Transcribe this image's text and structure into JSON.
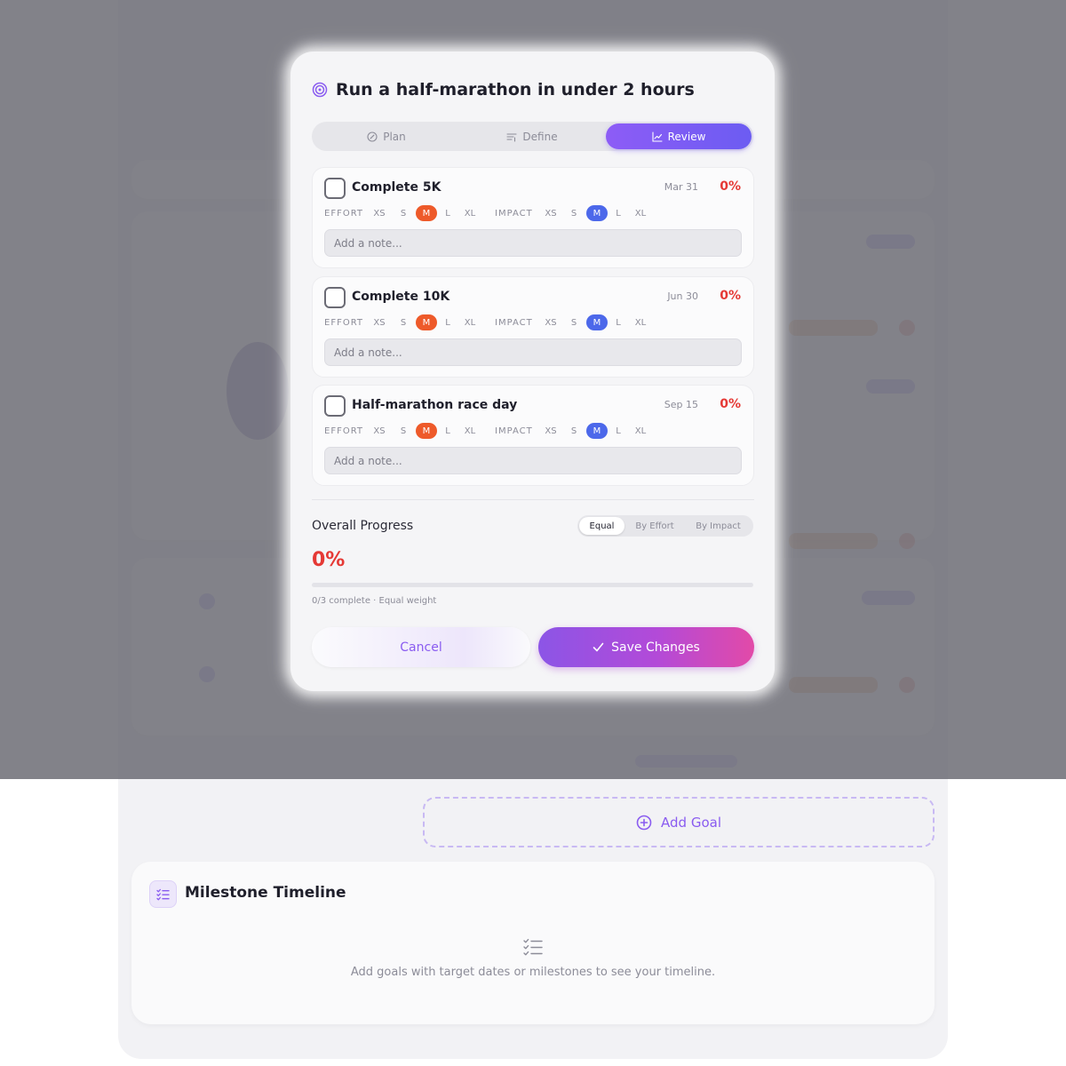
{
  "modal": {
    "title": "Run a half-marathon in under 2 hours",
    "tabs": [
      {
        "label": "Plan",
        "icon": "compass-icon"
      },
      {
        "label": "Define",
        "icon": "list-filter-icon"
      },
      {
        "label": "Review",
        "icon": "chart-line-icon",
        "active": true
      }
    ],
    "goals": [
      {
        "name": "Complete 5K",
        "date": "Mar 31",
        "percent": "0%",
        "effort": "M",
        "impact": "M",
        "note_placeholder": "Add a note..."
      },
      {
        "name": "Complete 10K",
        "date": "Jun 30",
        "percent": "0%",
        "effort": "M",
        "impact": "M",
        "note_placeholder": "Add a note..."
      },
      {
        "name": "Half-marathon race day",
        "date": "Sep 15",
        "percent": "0%",
        "effort": "M",
        "impact": "M",
        "note_placeholder": "Add a note..."
      }
    ],
    "size_labels": {
      "effort": "EFFORT",
      "impact": "IMPACT"
    },
    "size_options": [
      "XS",
      "S",
      "M",
      "L",
      "XL"
    ],
    "progress": {
      "label": "Overall Progress",
      "value": "0%",
      "fraction": 0,
      "summary": "0/3 complete · Equal weight",
      "weight_modes": [
        "Equal",
        "By Effort",
        "By Impact"
      ],
      "active_mode": "Equal"
    },
    "buttons": {
      "cancel": "Cancel",
      "save": "Save Changes"
    }
  },
  "page": {
    "add_goal": "Add Goal",
    "timeline": {
      "title": "Milestone Timeline",
      "empty_message": "Add goals with target dates or milestones to see your timeline."
    }
  },
  "colors": {
    "accent": "#8a5cf0",
    "danger": "#e53935",
    "effort_selected": "#ee5a2a",
    "impact_selected": "#4c68ea"
  }
}
